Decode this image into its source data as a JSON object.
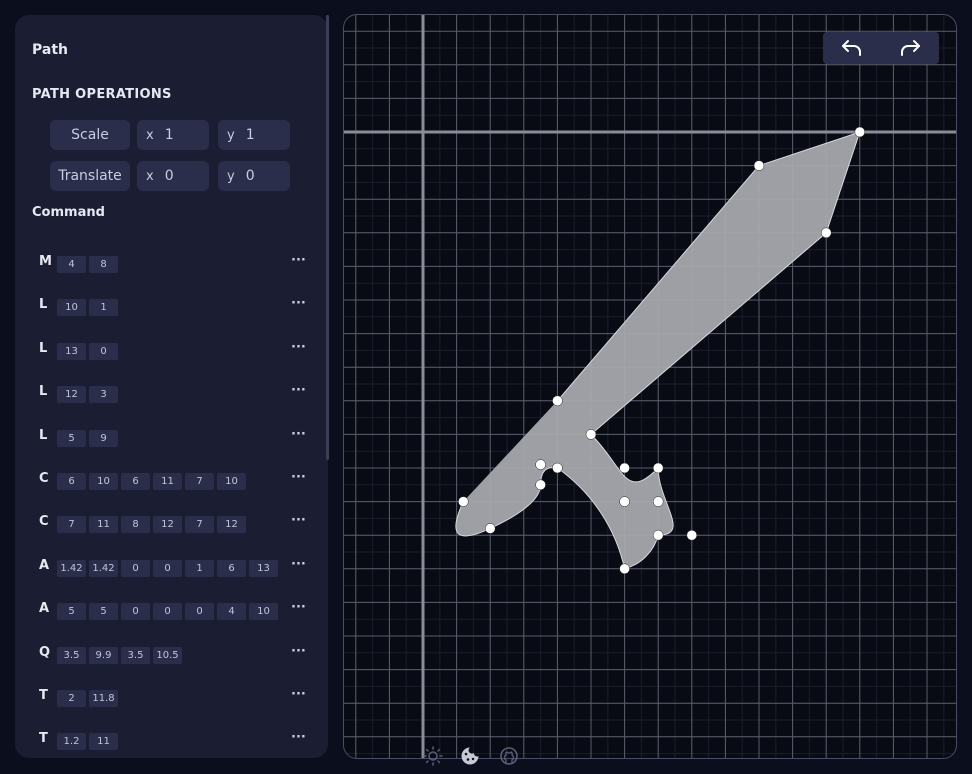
{
  "sidebar": {
    "title": "Path",
    "operations_title": "PATH OPERATIONS",
    "commands_title": "Command",
    "operations": [
      {
        "label": "Scale",
        "x_label": "x",
        "x_value": "1",
        "y_label": "y",
        "y_value": "1"
      },
      {
        "label": "Translate",
        "x_label": "x",
        "x_value": "0",
        "y_label": "y",
        "y_value": "0"
      }
    ],
    "commands": [
      {
        "letter": "M",
        "values": [
          "4",
          "8"
        ]
      },
      {
        "letter": "L",
        "values": [
          "10",
          "1"
        ]
      },
      {
        "letter": "L",
        "values": [
          "13",
          "0"
        ]
      },
      {
        "letter": "L",
        "values": [
          "12",
          "3"
        ]
      },
      {
        "letter": "L",
        "values": [
          "5",
          "9"
        ]
      },
      {
        "letter": "C",
        "values": [
          "6",
          "10",
          "6",
          "11",
          "7",
          "10"
        ]
      },
      {
        "letter": "C",
        "values": [
          "7",
          "11",
          "8",
          "12",
          "7",
          "12"
        ]
      },
      {
        "letter": "A",
        "values": [
          "1.42",
          "1.42",
          "0",
          "0",
          "1",
          "6",
          "13"
        ]
      },
      {
        "letter": "A",
        "values": [
          "5",
          "5",
          "0",
          "0",
          "0",
          "4",
          "10"
        ]
      },
      {
        "letter": "Q",
        "values": [
          "3.5",
          "9.9",
          "3.5",
          "10.5"
        ]
      },
      {
        "letter": "T",
        "values": [
          "2",
          "11.8"
        ]
      },
      {
        "letter": "T",
        "values": [
          "1.2",
          "11"
        ]
      }
    ],
    "more_label": "···"
  },
  "toolbar": {
    "undo_icon": "undo-icon",
    "redo_icon": "redo-icon"
  },
  "footer": {
    "icons": [
      "sun-icon",
      "cookie-icon",
      "github-icon"
    ]
  },
  "colors": {
    "background": "#0b0e1d",
    "panel": "#1b1e33",
    "field": "#2a2e4a",
    "shape_fill": "#a7a8ad",
    "point": "#ffffff"
  }
}
